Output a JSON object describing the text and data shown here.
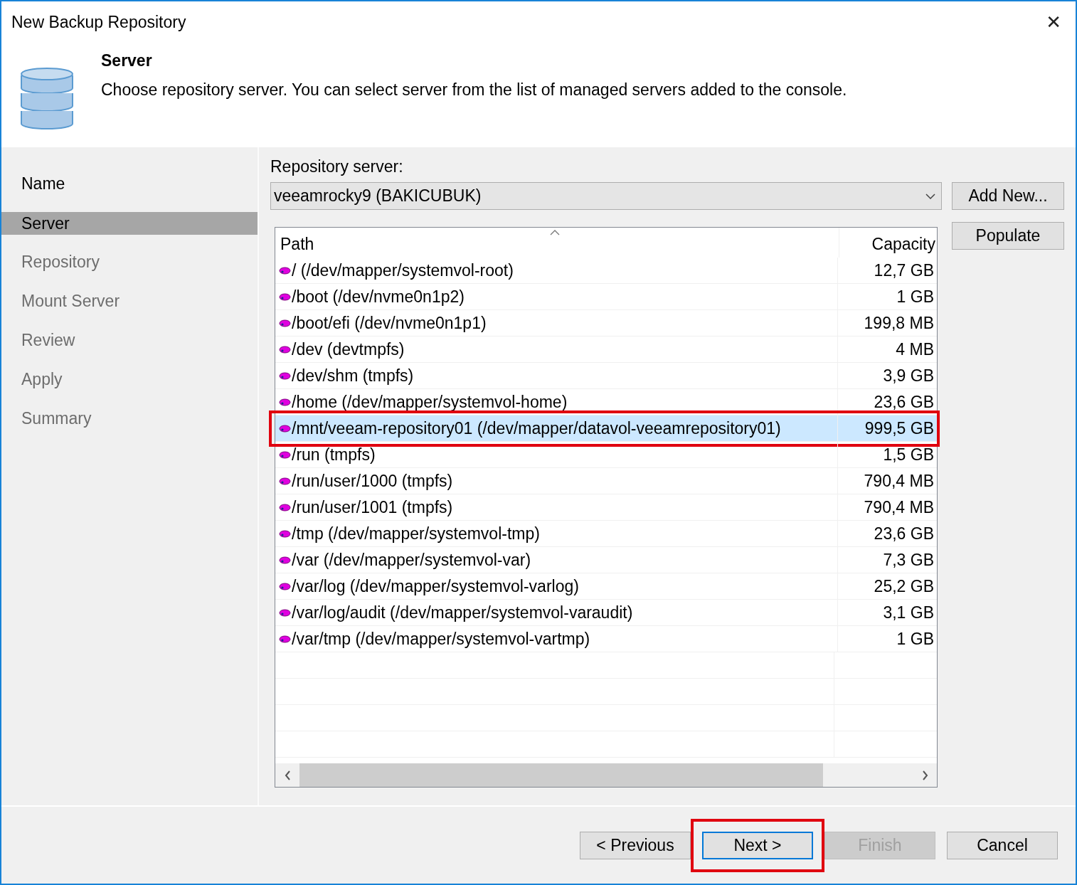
{
  "window": {
    "title": "New Backup Repository",
    "close": "✕"
  },
  "header": {
    "title": "Server",
    "description": "Choose repository server. You can select server from the list of managed servers added to the console."
  },
  "steps": [
    {
      "label": "Name",
      "selected": false,
      "disabled": false
    },
    {
      "label": "Server",
      "selected": true,
      "disabled": false
    },
    {
      "label": "Repository",
      "selected": false,
      "disabled": true
    },
    {
      "label": "Mount Server",
      "selected": false,
      "disabled": true
    },
    {
      "label": "Review",
      "selected": false,
      "disabled": true
    },
    {
      "label": "Apply",
      "selected": false,
      "disabled": true
    },
    {
      "label": "Summary",
      "selected": false,
      "disabled": true
    }
  ],
  "server": {
    "label": "Repository server:",
    "value": "veeamrocky9 (BAKICUBUK)"
  },
  "side_buttons": [
    "Add New...",
    "Populate"
  ],
  "table": {
    "columns": [
      "Path",
      "Capacity"
    ],
    "rows": [
      {
        "path": "/ (/dev/mapper/systemvol-root)",
        "capacity": "12,7 GB",
        "selected": false,
        "highlighted": false
      },
      {
        "path": "/boot (/dev/nvme0n1p2)",
        "capacity": "1 GB",
        "selected": false,
        "highlighted": false
      },
      {
        "path": "/boot/efi (/dev/nvme0n1p1)",
        "capacity": "199,8 MB",
        "selected": false,
        "highlighted": false
      },
      {
        "path": "/dev (devtmpfs)",
        "capacity": "4 MB",
        "selected": false,
        "highlighted": false
      },
      {
        "path": "/dev/shm (tmpfs)",
        "capacity": "3,9 GB",
        "selected": false,
        "highlighted": false
      },
      {
        "path": "/home (/dev/mapper/systemvol-home)",
        "capacity": "23,6 GB",
        "selected": false,
        "highlighted": false
      },
      {
        "path": "/mnt/veeam-repository01 (/dev/mapper/datavol-veeamrepository01)",
        "capacity": "999,5 GB",
        "selected": true,
        "highlighted": true
      },
      {
        "path": "/run (tmpfs)",
        "capacity": "1,5 GB",
        "selected": false,
        "highlighted": false
      },
      {
        "path": "/run/user/1000 (tmpfs)",
        "capacity": "790,4 MB",
        "selected": false,
        "highlighted": false
      },
      {
        "path": "/run/user/1001 (tmpfs)",
        "capacity": "790,4 MB",
        "selected": false,
        "highlighted": false
      },
      {
        "path": "/tmp (/dev/mapper/systemvol-tmp)",
        "capacity": "23,6 GB",
        "selected": false,
        "highlighted": false
      },
      {
        "path": "/var (/dev/mapper/systemvol-var)",
        "capacity": "7,3 GB",
        "selected": false,
        "highlighted": false
      },
      {
        "path": "/var/log (/dev/mapper/systemvol-varlog)",
        "capacity": "25,2 GB",
        "selected": false,
        "highlighted": false
      },
      {
        "path": "/var/log/audit (/dev/mapper/systemvol-varaudit)",
        "capacity": "3,1 GB",
        "selected": false,
        "highlighted": false
      },
      {
        "path": "/var/tmp (/dev/mapper/systemvol-vartmp)",
        "capacity": "1 GB",
        "selected": false,
        "highlighted": false
      }
    ]
  },
  "footer_buttons": [
    {
      "label": "< Previous",
      "disabled": false,
      "default": false,
      "highlighted": false
    },
    {
      "label": "Next >",
      "disabled": false,
      "default": true,
      "highlighted": true
    },
    {
      "label": "Finish",
      "disabled": true,
      "default": false,
      "highlighted": false
    },
    {
      "label": "Cancel",
      "disabled": false,
      "default": false,
      "highlighted": false
    }
  ]
}
